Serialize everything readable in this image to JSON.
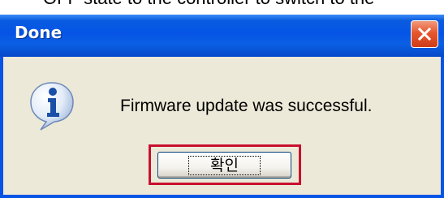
{
  "background_text": "OFF state to the controller to switch to the",
  "dialog": {
    "title": "Done",
    "message": "Firmware update was successful.",
    "ok_label": "확인"
  },
  "icons": {
    "close": "close-icon",
    "info": "info-icon"
  },
  "colors": {
    "titlebar": "#0554e6",
    "close_button": "#e5562e",
    "dialog_background": "#ece9d8",
    "highlight_border": "#c8102e"
  }
}
